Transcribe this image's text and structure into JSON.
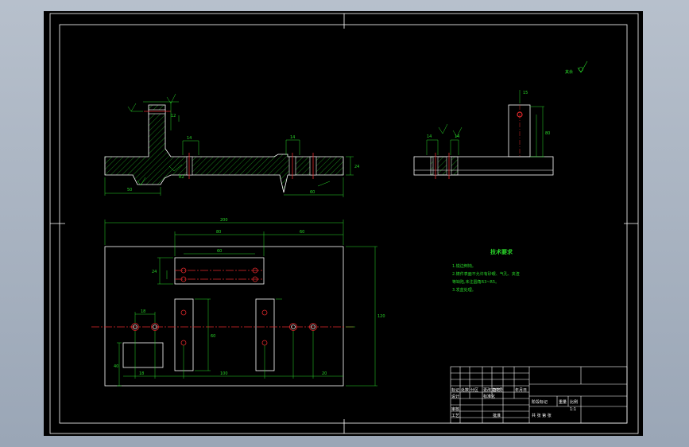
{
  "drawing": {
    "colors": {
      "background": "#000000",
      "outline": "#ffffff",
      "dimension": "#29d629",
      "center_line": "#e0282b",
      "workspace": "#a7b1c0"
    },
    "roughness_note": "其余",
    "tech_requirements": {
      "title": "技术要求",
      "lines": [
        "1.锐边倒钝。",
        "2.铸件表面不允许有砂眼、气孔、夹渣",
        "等缺陷,未注圆角R3~R5。",
        "3.发蓝处理。"
      ]
    },
    "title_block": {
      "cells": [
        "标记",
        "处数",
        "分区",
        "更改文件号",
        "签名",
        "年月日",
        "设计",
        "标准化",
        "审核",
        "工艺",
        "批准",
        "阶段标记",
        "重量",
        "比例",
        "1:1",
        "共 张 第 张"
      ]
    }
  }
}
